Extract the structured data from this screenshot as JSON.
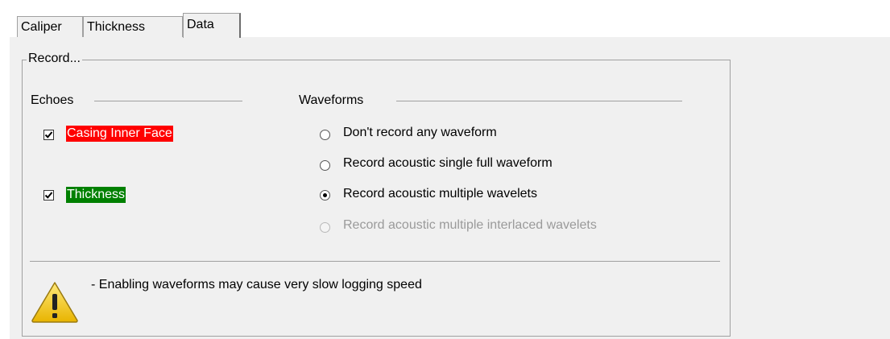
{
  "tabs": [
    {
      "label": "Caliper"
    },
    {
      "label": "Thickness"
    },
    {
      "label": "Data",
      "active": true
    }
  ],
  "record_group": {
    "title": "Record...",
    "echoes": {
      "heading": "Echoes",
      "items": [
        {
          "label": "Casing Inner Face",
          "checked": true,
          "highlight": "#ff0000"
        },
        {
          "label": "Thickness",
          "checked": true,
          "highlight": "#008000"
        }
      ]
    },
    "waveforms": {
      "heading": "Waveforms",
      "options": [
        {
          "label": "Don't record any waveform",
          "selected": false,
          "enabled": true
        },
        {
          "label": "Record acoustic single full waveform",
          "selected": false,
          "enabled": true
        },
        {
          "label": "Record acoustic multiple wavelets",
          "selected": true,
          "enabled": true
        },
        {
          "label": "Record acoustic multiple interlaced wavelets",
          "selected": false,
          "enabled": false
        }
      ]
    },
    "warning": {
      "icon": "warning-icon",
      "text": "- Enabling waveforms may cause very slow logging speed"
    }
  }
}
